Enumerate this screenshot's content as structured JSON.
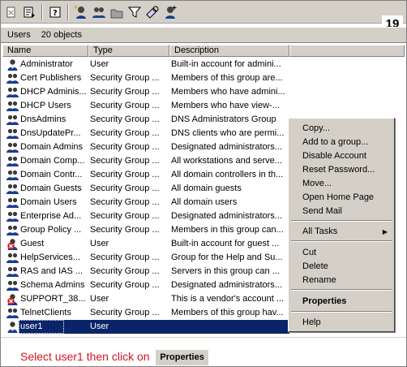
{
  "step_number": "19",
  "infobar": {
    "container": "Users",
    "count": "20 objects"
  },
  "columns": [
    "Name",
    "Type",
    "Description"
  ],
  "rows": [
    {
      "name": "Administrator",
      "type": "User",
      "desc": "Built-in account for admini...",
      "icon": "user-icon"
    },
    {
      "name": "Cert Publishers",
      "type": "Security Group ...",
      "desc": "Members of this group are...",
      "icon": "group-icon"
    },
    {
      "name": "DHCP Adminis...",
      "type": "Security Group ...",
      "desc": "Members who have admini...",
      "icon": "group-icon"
    },
    {
      "name": "DHCP Users",
      "type": "Security Group ...",
      "desc": "Members who have view-...",
      "icon": "group-icon"
    },
    {
      "name": "DnsAdmins",
      "type": "Security Group ...",
      "desc": "DNS Administrators Group",
      "icon": "group-icon"
    },
    {
      "name": "DnsUpdatePr...",
      "type": "Security Group ...",
      "desc": "DNS clients who are permi...",
      "icon": "group-icon"
    },
    {
      "name": "Domain Admins",
      "type": "Security Group ...",
      "desc": "Designated administrators...",
      "icon": "group-icon"
    },
    {
      "name": "Domain Comp...",
      "type": "Security Group ...",
      "desc": "All workstations and serve...",
      "icon": "group-icon"
    },
    {
      "name": "Domain Contr...",
      "type": "Security Group ...",
      "desc": "All domain controllers in th...",
      "icon": "group-icon"
    },
    {
      "name": "Domain Guests",
      "type": "Security Group ...",
      "desc": "All domain guests",
      "icon": "group-icon"
    },
    {
      "name": "Domain Users",
      "type": "Security Group ...",
      "desc": "All domain users",
      "icon": "group-icon"
    },
    {
      "name": "Enterprise Ad...",
      "type": "Security Group ...",
      "desc": "Designated administrators...",
      "icon": "group-icon"
    },
    {
      "name": "Group Policy ...",
      "type": "Security Group ...",
      "desc": "Members in this group can...",
      "icon": "group-icon"
    },
    {
      "name": "Guest",
      "type": "User",
      "desc": "Built-in account for guest ...",
      "icon": "disabled-user-icon"
    },
    {
      "name": "HelpServices...",
      "type": "Security Group ...",
      "desc": "Group for the Help and Su...",
      "icon": "group-icon"
    },
    {
      "name": "RAS and IAS ...",
      "type": "Security Group ...",
      "desc": "Servers in this group can ...",
      "icon": "group-icon"
    },
    {
      "name": "Schema Admins",
      "type": "Security Group ...",
      "desc": "Designated administrators...",
      "icon": "group-icon"
    },
    {
      "name": "SUPPORT_38...",
      "type": "User",
      "desc": "This is a vendor's account ...",
      "icon": "disabled-user-icon"
    },
    {
      "name": "TelnetClients",
      "type": "Security Group ...",
      "desc": "Members of this group hav...",
      "icon": "group-icon"
    },
    {
      "name": "user1",
      "type": "User",
      "desc": "",
      "icon": "user-icon",
      "selected": true
    }
  ],
  "context_menu": {
    "copy": "Copy...",
    "add_to_group": "Add to a group...",
    "disable_account": "Disable Account",
    "reset_password": "Reset Password...",
    "move": "Move...",
    "open_home_page": "Open Home Page",
    "send_mail": "Send Mail",
    "all_tasks": "All Tasks",
    "cut": "Cut",
    "delete": "Delete",
    "rename": "Rename",
    "properties": "Properties",
    "help": "Help"
  },
  "instruction": {
    "text": "Select user1 then click on",
    "button": "Properties"
  },
  "colors": {
    "selection": "#0a246a",
    "instruction": "#d4141f",
    "chrome": "#d4d0c8"
  }
}
